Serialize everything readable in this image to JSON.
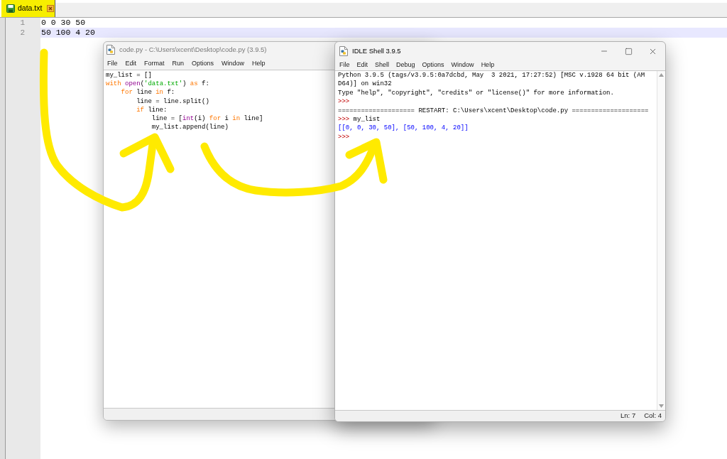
{
  "editor": {
    "tab": {
      "label": "data.txt"
    },
    "lines": [
      {
        "number": "1",
        "text": "0 0 30 50",
        "current": false
      },
      {
        "number": "2",
        "text": "50 100 4 20",
        "current": true
      }
    ]
  },
  "code_window": {
    "title": "code.py - C:\\Users\\xcent\\Desktop\\code.py (3.9.5)",
    "active": false,
    "menu": [
      "File",
      "Edit",
      "Format",
      "Run",
      "Options",
      "Window",
      "Help"
    ],
    "lines": [
      [
        {
          "kind": "plain",
          "text": "my_list = []"
        }
      ],
      [
        {
          "kind": "keyword",
          "text": "with"
        },
        {
          "kind": "builtin",
          "text": " open"
        },
        {
          "kind": "plain",
          "text": "("
        },
        {
          "kind": "string",
          "text": "'data.txt'"
        },
        {
          "kind": "plain",
          "text": ") "
        },
        {
          "kind": "keyword",
          "text": "as"
        },
        {
          "kind": "plain",
          "text": " f:"
        }
      ],
      [
        {
          "kind": "keyword",
          "text": "    for"
        },
        {
          "kind": "plain",
          "text": " line "
        },
        {
          "kind": "keyword",
          "text": "in"
        },
        {
          "kind": "plain",
          "text": " f:"
        }
      ],
      [
        {
          "kind": "plain",
          "text": "        line = line.split()"
        }
      ],
      [
        {
          "kind": "keyword",
          "text": "        if"
        },
        {
          "kind": "plain",
          "text": " line:"
        }
      ],
      [
        {
          "kind": "plain",
          "text": "            line = ["
        },
        {
          "kind": "builtin",
          "text": "int"
        },
        {
          "kind": "plain",
          "text": "(i) "
        },
        {
          "kind": "keyword",
          "text": "for"
        },
        {
          "kind": "plain",
          "text": " i "
        },
        {
          "kind": "keyword",
          "text": "in"
        },
        {
          "kind": "plain",
          "text": " line]"
        }
      ],
      [
        {
          "kind": "plain",
          "text": "            my_list.append(line)"
        }
      ]
    ]
  },
  "shell_window": {
    "title": "IDLE Shell 3.9.5",
    "active": true,
    "menu": [
      "File",
      "Edit",
      "Shell",
      "Debug",
      "Options",
      "Window",
      "Help"
    ],
    "lines": [
      [
        {
          "kind": "plain",
          "text": "Python 3.9.5 (tags/v3.9.5:0a7dcbd, May  3 2021, 17:27:52) [MSC v.1928 64 bit (AM"
        }
      ],
      [
        {
          "kind": "plain",
          "text": "D64)] on win32"
        }
      ],
      [
        {
          "kind": "plain",
          "text": "Type \"help\", \"copyright\", \"credits\" or \"license()\" for more information."
        }
      ],
      [
        {
          "kind": "prompt",
          "text": ">>>"
        }
      ],
      [
        {
          "kind": "plain",
          "text": "==================== RESTART: C:\\Users\\xcent\\Desktop\\code.py ===================="
        }
      ],
      [
        {
          "kind": "prompt",
          "text": ">>>"
        },
        {
          "kind": "plain",
          "text": " my_list"
        }
      ],
      [
        {
          "kind": "stdout",
          "text": "[[0, 0, 30, 50], [50, 100, 4, 20]]"
        }
      ],
      [
        {
          "kind": "prompt",
          "text": ">>>"
        }
      ]
    ],
    "status_bar": {
      "line": "Ln: 7",
      "column": "Col: 4"
    }
  }
}
